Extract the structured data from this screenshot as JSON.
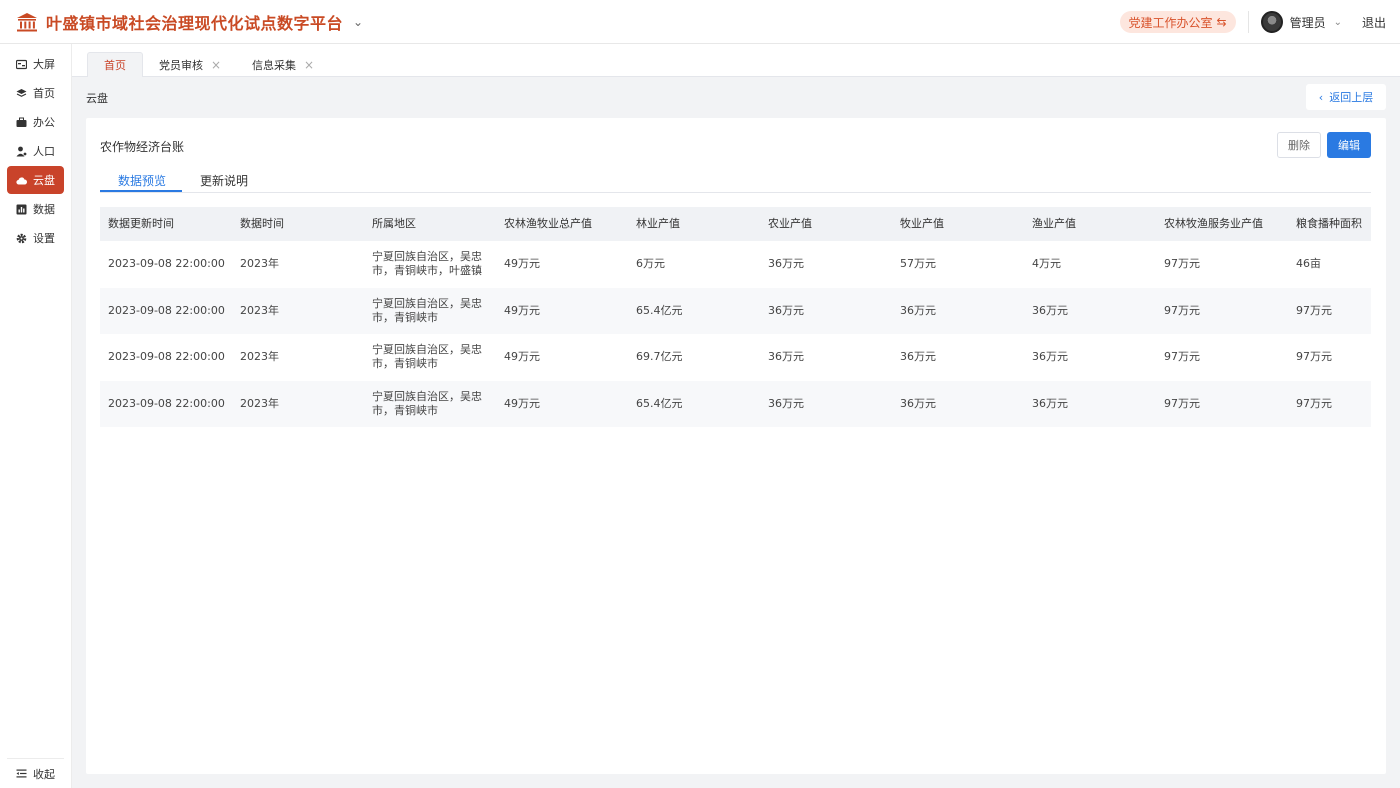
{
  "header": {
    "title": "叶盛镇市域社会治理现代化试点数字平台",
    "department": "党建工作办公室",
    "user": "管理员",
    "logout": "退出"
  },
  "sidebar": {
    "items": [
      {
        "label": "大屏",
        "icon": "screen-icon"
      },
      {
        "label": "首页",
        "icon": "layers-icon"
      },
      {
        "label": "办公",
        "icon": "briefcase-icon"
      },
      {
        "label": "人口",
        "icon": "person-icon"
      },
      {
        "label": "云盘",
        "icon": "cloud-icon"
      },
      {
        "label": "数据",
        "icon": "chart-icon"
      },
      {
        "label": "设置",
        "icon": "gear-icon"
      }
    ],
    "active": "云盘",
    "collapse": "收起"
  },
  "tabs": [
    {
      "label": "首页",
      "closable": false
    },
    {
      "label": "党员审核",
      "closable": true
    },
    {
      "label": "信息采集",
      "closable": true
    }
  ],
  "breadcrumb": "云盘",
  "back_label": "返回上层",
  "card": {
    "title": "农作物经济台账",
    "delete_label": "删除",
    "edit_label": "编辑",
    "subtabs": [
      "数据预览",
      "更新说明"
    ]
  },
  "table": {
    "columns": [
      "数据更新时间",
      "数据时间",
      "所属地区",
      "农林渔牧业总产值",
      "林业产值",
      "农业产值",
      "牧业产值",
      "渔业产值",
      "农林牧渔服务业产值",
      "粮食播种面积"
    ],
    "rows": [
      [
        "2023-09-08 22:00:00",
        "2023年",
        "宁夏回族自治区，吴忠市，青铜峡市，叶盛镇",
        "49万元",
        "6万元",
        "36万元",
        "57万元",
        "4万元",
        "97万元",
        "46亩"
      ],
      [
        "2023-09-08 22:00:00",
        "2023年",
        "宁夏回族自治区，吴忠市，青铜峡市",
        "49万元",
        "65.4亿元",
        "36万元",
        "36万元",
        "36万元",
        "97万元",
        "97万元"
      ],
      [
        "2023-09-08 22:00:00",
        "2023年",
        "宁夏回族自治区，吴忠市，青铜峡市",
        "49万元",
        "69.7亿元",
        "36万元",
        "36万元",
        "36万元",
        "97万元",
        "97万元"
      ],
      [
        "2023-09-08 22:00:00",
        "2023年",
        "宁夏回族自治区，吴忠市，青铜峡市",
        "49万元",
        "65.4亿元",
        "36万元",
        "36万元",
        "36万元",
        "97万元",
        "97万元"
      ]
    ]
  },
  "colors": {
    "brand": "#c9432a",
    "primary": "#2a7ae2"
  }
}
